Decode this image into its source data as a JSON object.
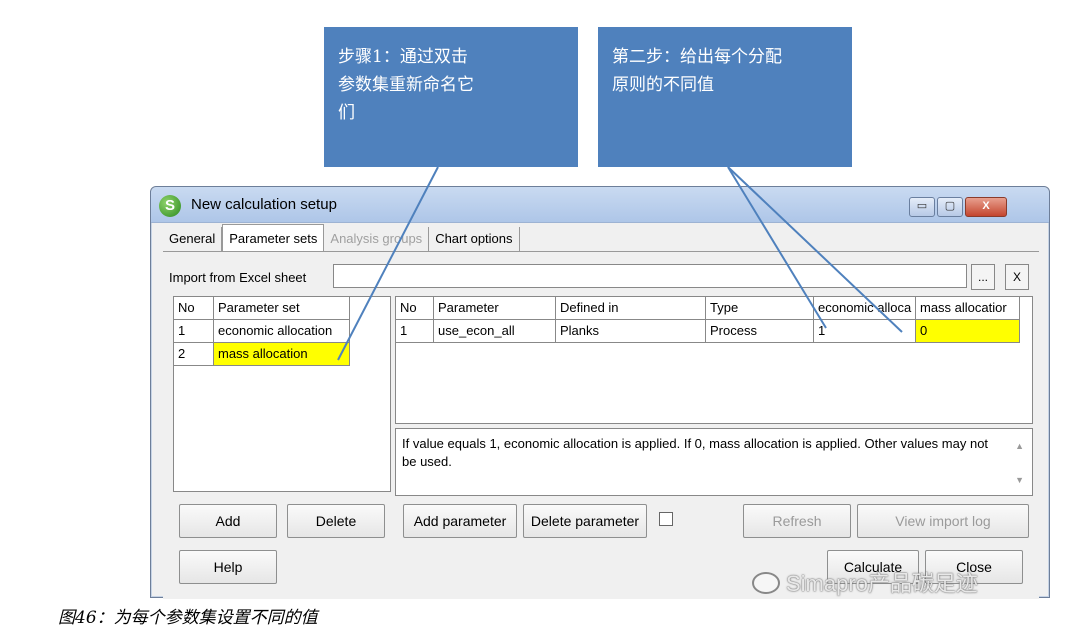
{
  "callouts": {
    "step1": "步骤1：通过双击\n参数集重新命名它\n们",
    "step2": "第二步：给出每个分配\n原则的不同值"
  },
  "window": {
    "title": "New calculation setup",
    "icon_letter": "S",
    "controls": {
      "minimize": "▭",
      "maximize": "▢",
      "close": "X"
    }
  },
  "tabs": [
    "General",
    "Parameter sets",
    "Analysis groups",
    "Chart options"
  ],
  "import": {
    "label": "Import from Excel sheet",
    "value": "",
    "browse": "...",
    "clear": "X"
  },
  "parameter_sets": {
    "headers": [
      "No",
      "Parameter set"
    ],
    "rows": [
      {
        "no": "1",
        "name": "economic allocation"
      },
      {
        "no": "2",
        "name": "mass allocation"
      }
    ]
  },
  "parameters": {
    "headers": [
      "No",
      "Parameter",
      "Defined in",
      "Type",
      "economic alloca",
      "mass allocatior"
    ],
    "rows": [
      {
        "no": "1",
        "parameter": "use_econ_all",
        "defined_in": "Planks",
        "type": "Process",
        "economic": "1",
        "mass": "0"
      }
    ]
  },
  "description": "If value equals 1, economic allocation is applied. If 0, mass allocation is applied. Other values may not be used.",
  "buttons": {
    "add": "Add",
    "delete": "Delete",
    "add_parameter": "Add parameter",
    "delete_parameter": "Delete parameter",
    "refresh": "Refresh",
    "view_import_log": "View import log",
    "help": "Help",
    "calculate": "Calculate",
    "close": "Close"
  },
  "watermark": "Simapro产品碳足迹",
  "caption": "图46：为每个参数集设置不同的值",
  "colors": {
    "callout": "#4f81bd",
    "highlight": "#ffff00"
  }
}
